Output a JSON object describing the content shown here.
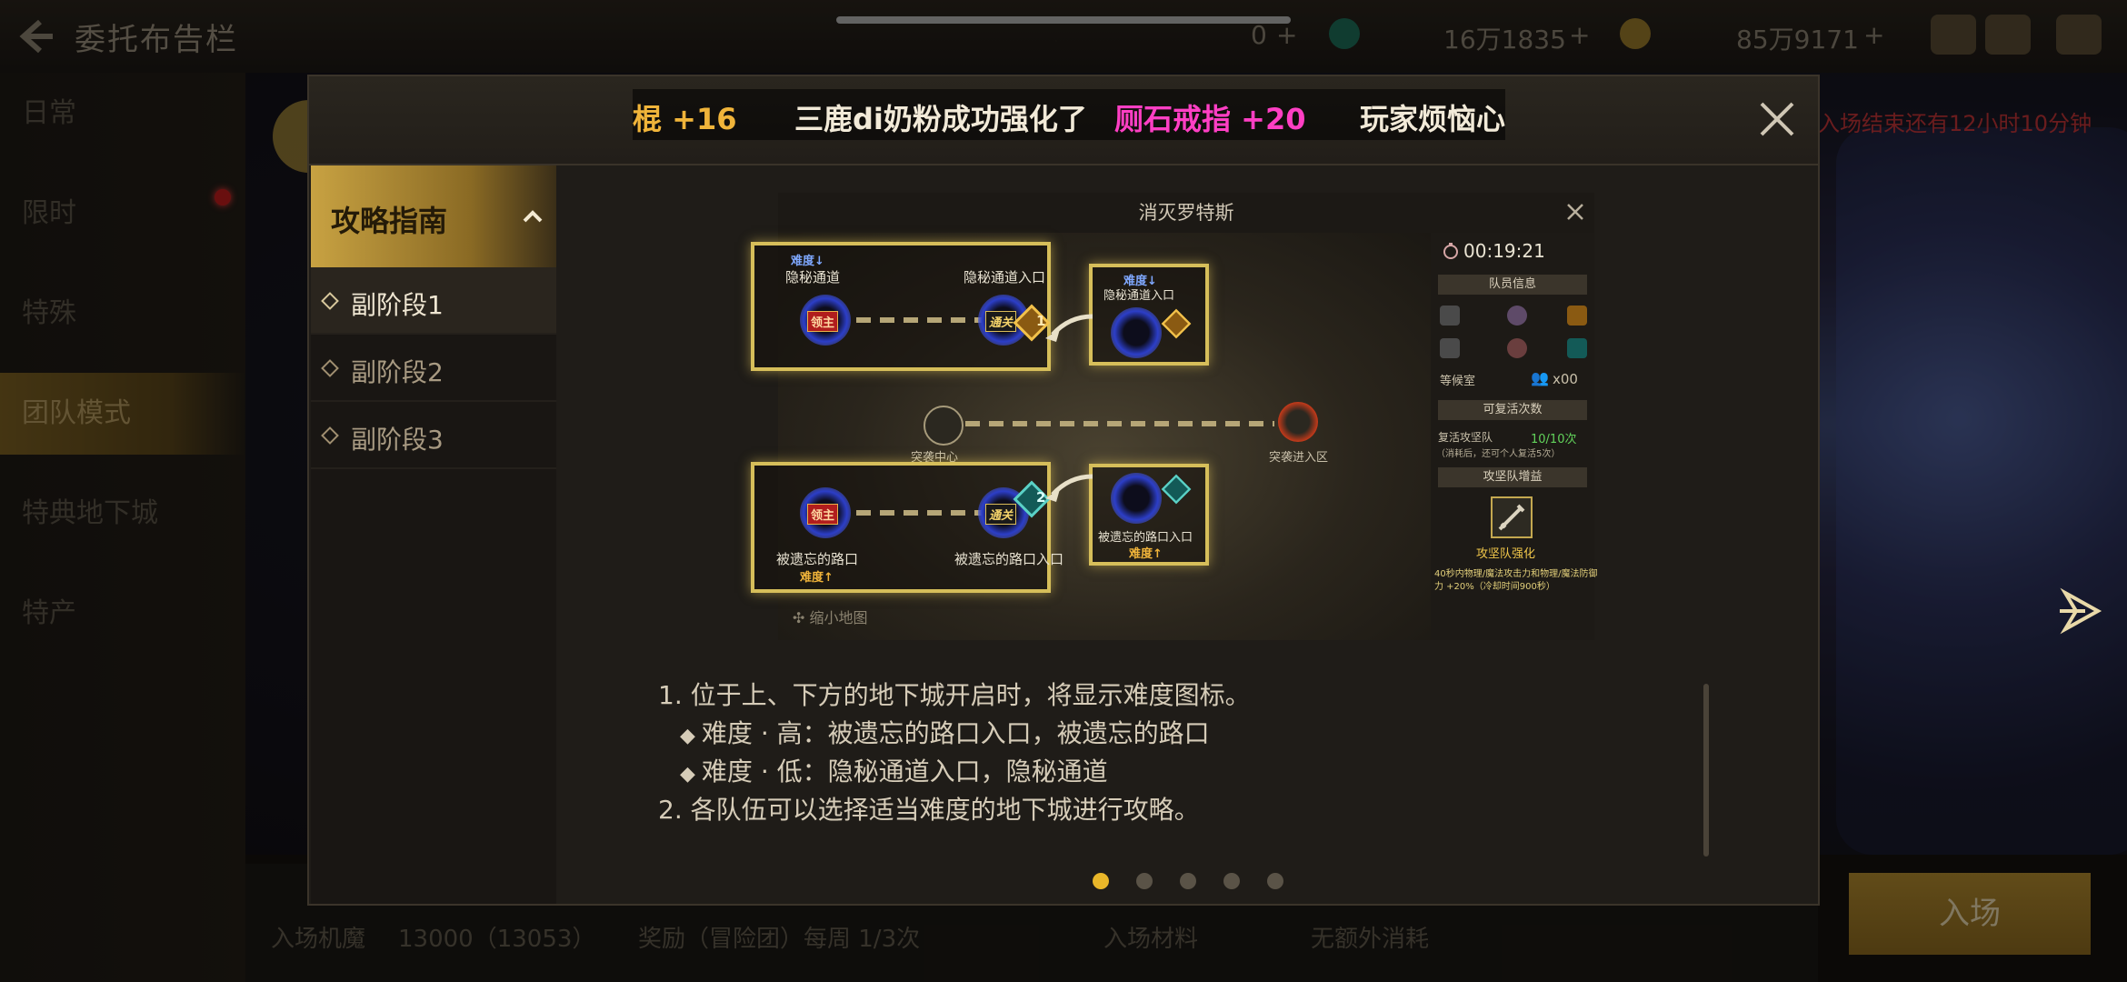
{
  "topbar": {
    "title": "委托布告栏",
    "currency_1": "0",
    "currency_2": "16万1835",
    "currency_3": "85万9171"
  },
  "left_nav": {
    "items": [
      {
        "label": "日常"
      },
      {
        "label": "限时"
      },
      {
        "label": "特殊"
      },
      {
        "label": "团队模式"
      },
      {
        "label": "特典地下城"
      },
      {
        "label": "特产"
      }
    ]
  },
  "background": {
    "red_notice": "入场结束还有12小时10分钟",
    "entry_tickets_label": "入场机魔",
    "entry_value": "13000（13053）",
    "reward_label": "奖励（冒险团）每周 1/3次",
    "material_label": "入场材料",
    "material_value": "无额外消耗",
    "enter_button": "入场"
  },
  "modal": {
    "marquee": {
      "part1": "棍 +16",
      "part2": "三鹿di奶粉成功强化了",
      "part3": "厕石戒指 +20",
      "part4": "玩家烦恼心事"
    },
    "side_nav": {
      "header": "攻略指南",
      "items": [
        {
          "label": "副阶段1"
        },
        {
          "label": "副阶段2"
        },
        {
          "label": "副阶段3"
        }
      ]
    },
    "guide": {
      "title": "消灭罗特斯",
      "top_left_diff": "难度↓",
      "top_left_name": "隐秘通道",
      "boss_tag": "领主",
      "clear_tag": "通关",
      "top_right_name": "隐秘通道入口",
      "top_entry_diff": "难度↓",
      "top_entry_name": "隐秘通道入口",
      "center_left": "突袭中心",
      "center_right": "突袭进入区",
      "bottom_left_name": "被遗忘的路口",
      "bottom_left_diff": "难度↑",
      "bottom_right_name": "被遗忘的路口入口",
      "bottom_entry_name": "被遗忘的路口入口",
      "bottom_entry_diff": "难度↑",
      "badge_1": "1",
      "badge_2": "2",
      "zoom_label": "缩小地图",
      "hud": {
        "timer": "00:19:21",
        "team_info": "队员信息",
        "waiting_room": "等候室",
        "waiting_count": "x00",
        "revive_header": "可复活次数",
        "revive_label": "复活攻坚队",
        "revive_value": "10/10次",
        "revive_note": "（消耗后，还可个人复活5次）",
        "buff_header": "攻坚队增益",
        "buff_name": "攻坚队强化",
        "buff_desc_1": "40秒内物理/魔法攻击力和物理/魔法防御",
        "buff_desc_2": "力 +20%（冷却时间900秒）"
      }
    },
    "description": {
      "line1": "1. 位于上、下方的地下城开启时，将显示难度图标。",
      "line2": "难度 · 高：被遗忘的路口入口，被遗忘的路口",
      "line3": "难度 · 低：隐秘通道入口，隐秘通道",
      "line4": "2. 各队伍可以选择适当难度的地下城进行攻略。"
    },
    "pagination": {
      "total": 5,
      "current": 1
    }
  },
  "colors": {
    "accent_gold": "#e8b629",
    "marquee_pink": "#ff3fc4",
    "marquee_orange": "#f0b43a"
  }
}
